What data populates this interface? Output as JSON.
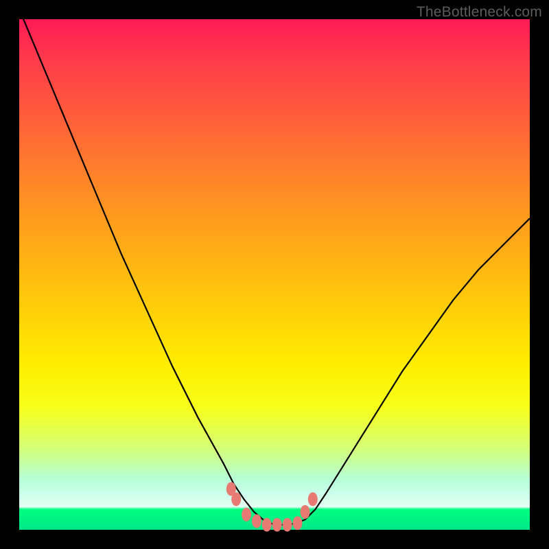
{
  "watermark": "TheBottleneck.com",
  "colors": {
    "background": "#000000",
    "curve": "#000000",
    "marker_fill": "#e77a73",
    "marker_stroke": "#e77a73"
  },
  "chart_data": {
    "type": "line",
    "title": "",
    "xlabel": "",
    "ylabel": "",
    "xlim": [
      0,
      100
    ],
    "ylim": [
      0,
      100
    ],
    "x": [
      0,
      5,
      10,
      15,
      20,
      25,
      30,
      35,
      40,
      42,
      44,
      46,
      48,
      50,
      52,
      54,
      56,
      58,
      60,
      65,
      70,
      75,
      80,
      85,
      90,
      95,
      100
    ],
    "values": [
      102,
      90,
      78,
      66,
      54,
      43,
      32,
      22,
      13,
      9,
      6,
      3.5,
      1.8,
      1.0,
      1.0,
      1.2,
      2.0,
      4.0,
      7.0,
      15,
      23,
      31,
      38,
      45,
      51,
      56,
      61
    ],
    "markers": {
      "x": [
        41.5,
        42.5,
        44.5,
        46.5,
        48.5,
        50.5,
        52.5,
        54.5,
        56.0,
        57.5
      ],
      "y": [
        8.0,
        6.0,
        3.0,
        1.7,
        1.0,
        1.0,
        1.0,
        1.3,
        3.5,
        6.0
      ]
    },
    "gradient_stops": [
      {
        "pos": 0.0,
        "color": "#ff1a55"
      },
      {
        "pos": 0.68,
        "color": "#ffee00"
      },
      {
        "pos": 0.96,
        "color": "#00ff80"
      }
    ]
  }
}
